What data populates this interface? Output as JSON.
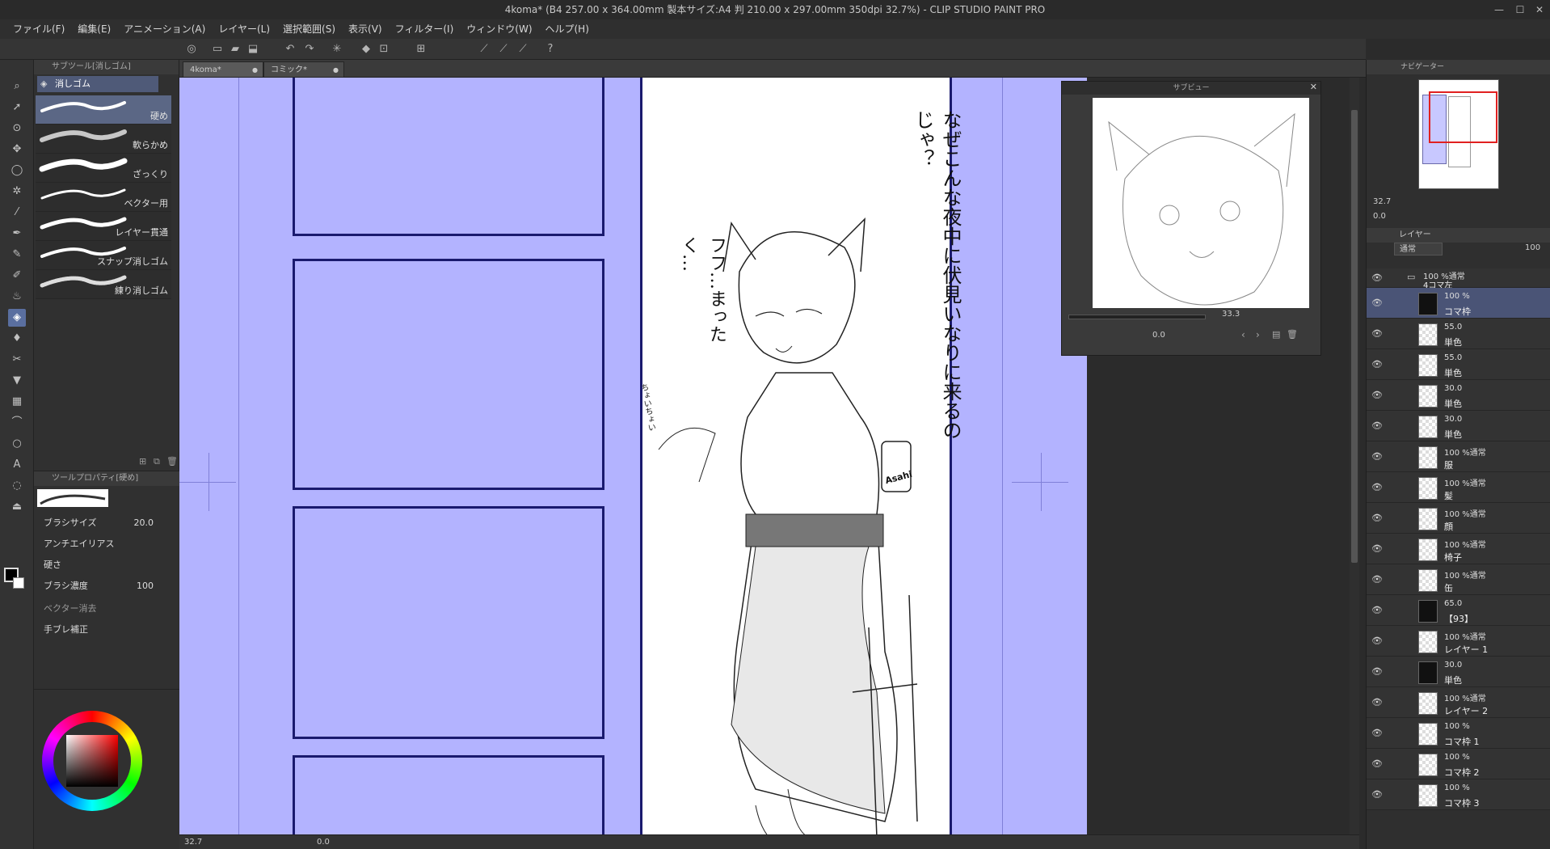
{
  "window": {
    "title": "4koma* (B4 257.00 x 364.00mm 製本サイズ:A4 判 210.00 x 297.00mm 350dpi 32.7%) - CLIP STUDIO PAINT PRO",
    "minimize": "—",
    "maximize": "☐",
    "close": "✕"
  },
  "menu": [
    "ファイル(F)",
    "編集(E)",
    "アニメーション(A)",
    "レイヤー(L)",
    "選択範囲(S)",
    "表示(V)",
    "フィルター(I)",
    "ウィンドウ(W)",
    "ヘルプ(H)"
  ],
  "subtool_panel": {
    "header": "サブツール[消しゴム]",
    "group": "消しゴム",
    "brushes": [
      "硬め",
      "軟らかめ",
      "ざっくり",
      "ベクター用",
      "レイヤー貫通",
      "スナップ消しゴム",
      "練り消しゴム"
    ]
  },
  "tool_property": {
    "header": "ツールプロパティ[硬め]",
    "brush_size_label": "ブラシサイズ",
    "brush_size_value": "20.0",
    "antialias_label": "アンチエイリアス",
    "hardness_label": "硬さ",
    "density_label": "ブラシ濃度",
    "density_value": "100",
    "vector_erase_label": "ベクター消去",
    "stabilizer_label": "手ブレ補正"
  },
  "color": {
    "main": "#000000",
    "sub": "#ffffff",
    "r": "0",
    "g": "0",
    "b": "0",
    "hue_indicator": "#ff0000"
  },
  "tabs": [
    {
      "label": "4koma*",
      "close": "●"
    },
    {
      "label": "コミック*",
      "close": "●"
    }
  ],
  "canvas": {
    "panel_bg": "#b3b3ff",
    "border": "#1a1a6e",
    "speech1": "なぜこんな夜中に伏見いなりに来るのじゃ？",
    "speech2": "フフ…まったく…",
    "sfx": "ちょいちょい",
    "can_label": "Asahi"
  },
  "subview": {
    "title": "サブビュー",
    "zoom": "33.3",
    "angle": "0.0"
  },
  "navigator": {
    "tab1": "ナビゲーター",
    "zoom": "32.7",
    "angle": "0.0"
  },
  "layer_panel": {
    "tab": "レイヤー",
    "blend": "通常",
    "opacity": "100",
    "folder": {
      "meta": "100 %通常",
      "name": "4コマ左"
    },
    "layers": [
      {
        "meta": "100 %",
        "name": "コマ枠",
        "selected": true
      },
      {
        "meta": "55.0",
        "name": "単色"
      },
      {
        "meta": "55.0",
        "name": "単色"
      },
      {
        "meta": "30.0",
        "name": "単色"
      },
      {
        "meta": "30.0",
        "name": "単色"
      },
      {
        "meta": "100 %通常",
        "name": "服"
      },
      {
        "meta": "100 %通常",
        "name": "髪"
      },
      {
        "meta": "100 %通常",
        "name": "顔"
      },
      {
        "meta": "100 %通常",
        "name": "椅子"
      },
      {
        "meta": "100 %通常",
        "name": "缶"
      },
      {
        "meta": "65.0",
        "name": "【93】"
      },
      {
        "meta": "100 %通常",
        "name": "レイヤー 1"
      },
      {
        "meta": "30.0",
        "name": "単色"
      },
      {
        "meta": "100 %通常",
        "name": "レイヤー 2"
      },
      {
        "meta": "100 %",
        "name": "コマ枠 1"
      },
      {
        "meta": "100 %",
        "name": "コマ枠 2"
      },
      {
        "meta": "100 %",
        "name": "コマ枠 3"
      }
    ]
  },
  "statusbar": {
    "zoom": "32.7",
    "angle": "0.0"
  }
}
